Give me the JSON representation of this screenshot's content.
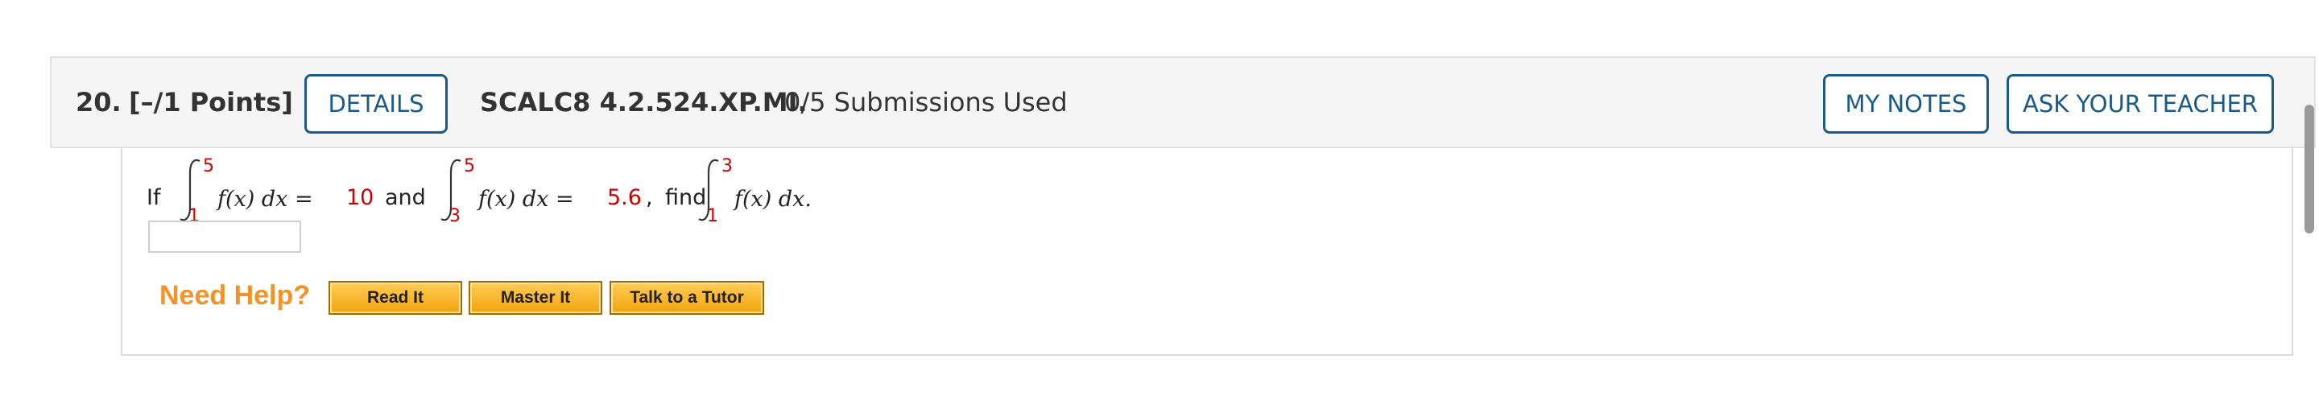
{
  "question": {
    "number": "20.",
    "points": "[–/1 Points]",
    "code": "SCALC8 4.2.524.XP.MI.",
    "submissions": "0/5 Submissions Used"
  },
  "buttons": {
    "details": "DETAILS",
    "my_notes": "MY NOTES",
    "ask_teacher": "ASK YOUR TEACHER"
  },
  "problem": {
    "if": "If",
    "and": "and",
    "find": "find",
    "integral1": {
      "lower": "1",
      "upper": "5",
      "integrand": "f(x) dx =",
      "value": "10"
    },
    "integral2": {
      "lower": "3",
      "upper": "5",
      "integrand": "f(x) dx =",
      "value": "5.6",
      "trail": ","
    },
    "integral3": {
      "lower": "1",
      "upper": "3",
      "integrand": "f(x) dx."
    }
  },
  "answer_input": {
    "value": ""
  },
  "help": {
    "label": "Need Help?",
    "read_it": "Read It",
    "master_it": "Master It",
    "talk_tutor": "Talk to a Tutor"
  },
  "colors": {
    "accent_blue": "#1a5a8a",
    "value_red": "#cc0000",
    "help_orange": "#f0932b"
  }
}
